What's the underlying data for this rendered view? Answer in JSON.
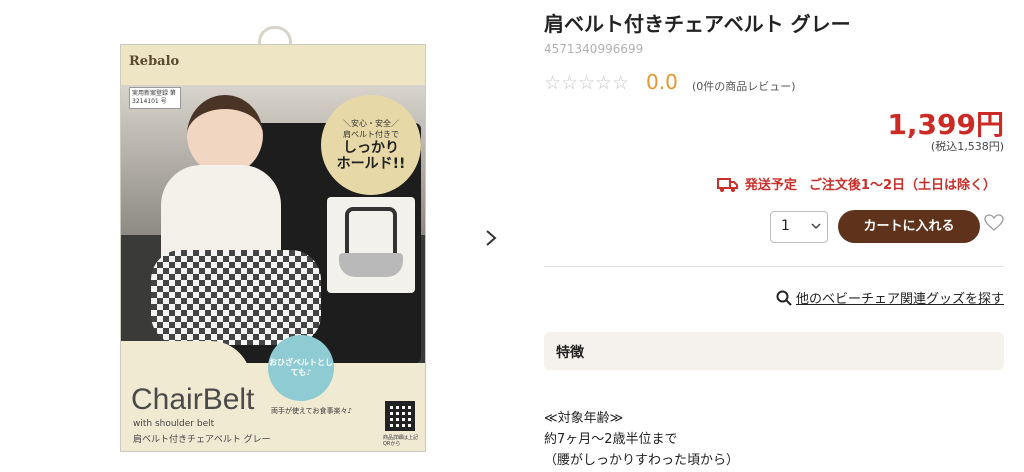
{
  "product_image": {
    "brand": "Rebalo",
    "patent_label": "実用新案登録 第 3214101 号",
    "badge_lines": [
      "＼安心・安全／",
      "肩ベルト付きで",
      "しっかり",
      "ホールド!!"
    ],
    "bubble_text": "おひざベルトとしても♪",
    "package_title": "ChairBelt",
    "package_subtitle": "with shoulder belt",
    "package_name_jp": "肩ベルト付きチェアベルト グレー",
    "package_note": "両手が使えてお食事楽々♪",
    "qr_caption": "商品詳細は上記QRから"
  },
  "gallery": {
    "next_icon": "chevron-right-icon"
  },
  "product": {
    "title": "肩ベルト付きチェアベルト グレー",
    "sku": "4571340996699",
    "stars": "☆☆☆☆☆",
    "rating": "0.0",
    "reviews": "(0件の商品レビュー)",
    "price": "1,399円",
    "price_tax": "(税込1,538円)",
    "shipping_label": "発送予定",
    "shipping_value": "ご注文後1〜2日（土日は除く）",
    "quantity": "1",
    "cart_button": "カートに入れる",
    "related_link": "他のベビーチェア関連グッズを探す",
    "feature_heading": "特徴",
    "description": [
      "≪対象年齢≫",
      "約7ヶ月〜2歳半位まで",
      "（腰がしっかりすわった頃から）"
    ]
  },
  "colors": {
    "price": "#cc2a24",
    "cart_button": "#5f331b",
    "rating": "#e8952c"
  }
}
